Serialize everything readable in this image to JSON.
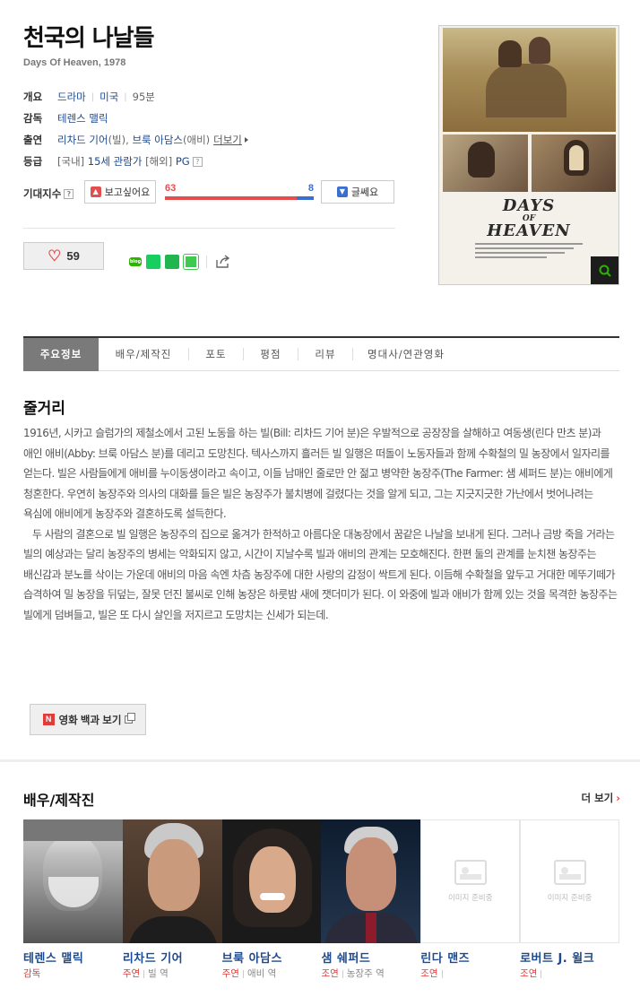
{
  "movie": {
    "title": "천국의 나날들",
    "subtitle": "Days Of Heaven, 1978"
  },
  "info": {
    "overview_key": "개요",
    "genre": "드라마",
    "country": "미국",
    "runtime": "95분",
    "director_key": "감독",
    "director": "테렌스 맬릭",
    "cast_key": "출연",
    "cast_1": "리차드 기어",
    "cast_1_role": "(빌)",
    "cast_2": "브룩 아담스",
    "cast_2_role": "(애비)",
    "cast_more": "더보기",
    "rating_key": "등급",
    "rating_kr_label": "[국내]",
    "rating_kr": "15세 관람가",
    "rating_intl_label": "[해외]",
    "rating_intl": "PG"
  },
  "expectation": {
    "label": "기대지수",
    "want_label": "보고싶어요",
    "dont_label": "글쎄요",
    "want_count": "63",
    "dont_count": "8",
    "want_ratio": 0.887
  },
  "actions": {
    "like_count": "59"
  },
  "icons": {
    "heart": "heart-icon",
    "question": "question-icon",
    "share": "share-icon",
    "zoom": "search-icon",
    "thumb_up": "thumbs-up-icon",
    "thumb_down": "thumbs-down-icon"
  },
  "poster": {
    "title_line1": "DAYS",
    "title_line2": "OF",
    "title_line3": "HEAVEN"
  },
  "tabs": [
    {
      "label": "주요정보"
    },
    {
      "label": "배우/제작진"
    },
    {
      "label": "포토"
    },
    {
      "label": "평점"
    },
    {
      "label": "리뷰"
    },
    {
      "label": "명대사/연관영화"
    }
  ],
  "plot": {
    "heading": "줄거리",
    "paragraph_1": "1916년, 시카고 슬럼가의 제철소에서 고된 노동을 하는 빌(Bill: 리차드 기어 분)은 우발적으로 공장장을 살해하고 여동생(린다 만츠 분)과 애인 애비(Abby: 브룩 아담스 분)를 데리고 도망친다. 텍사스까지 흘러든 빌 일행은 떠돌이 노동자들과 함께 수확철의 밀 농장에서 일자리를 얻는다. 빌은 사람들에게 애비를 누이동생이라고 속이고, 이들 남매인 줄로만 안 젊고 병약한 농장주(The Farmer: 샘 셰퍼드 분)는 애비에게 청혼한다. 우연히 농장주와 의사의 대화를 들은 빌은 농장주가 불치병에 걸렸다는 것을 알게 되고, 그는 지긋지긋한 가난에서 벗어나려는 욕심에 애비에게 농장주와 결혼하도록 설득한다.",
    "paragraph_2": "두 사람의 결혼으로 빌 일행은 농장주의 집으로 옮겨가 한적하고 아름다운 대농장에서 꿈같은 나날을 보내게 된다. 그러나 금방 죽을 거라는 빌의 예상과는 달리 농장주의 병세는 악화되지 않고, 시간이 지날수록 빌과 애비의 관계는 모호해진다. 한편 둘의 관계를 눈치챈 농장주는 배신감과 분노를 삭이는 가운데 애비의 마음 속엔 차츰 농장주에 대한 사랑의 감정이 싹트게 된다. 이듬해 수확철을 앞두고 거대한 메뚜기떼가 습격하여 밀 농장을 뒤덮는, 잘못 던진 불씨로 인해 농장은 하룻밤 새에 잿더미가 된다. 이 와중에 빌과 애비가 함께 있는 것을 목격한 농장주는 빌에게 덤벼들고, 빌은 또 다시 살인을 저지르고 도망치는 신세가 되는데."
  },
  "encyclopedia": {
    "n_label": "N",
    "label": "영화 백과 보기"
  },
  "cast_section": {
    "heading": "배우/제작진",
    "more": "더 보기",
    "no_image_text": "이미지 준비중",
    "people": [
      {
        "name": "테렌스 맬릭",
        "role": "감독",
        "part": ""
      },
      {
        "name": "리차드 기어",
        "role": "주연",
        "part": "빌 역"
      },
      {
        "name": "브룩 아담스",
        "role": "주연",
        "part": "애비 역"
      },
      {
        "name": "샘 쉐퍼드",
        "role": "조연",
        "part": "농장주 역"
      },
      {
        "name": "린다 맨즈",
        "role": "조연",
        "part": ""
      },
      {
        "name": "로버트 J. 윌크",
        "role": "조연",
        "part": ""
      }
    ]
  }
}
